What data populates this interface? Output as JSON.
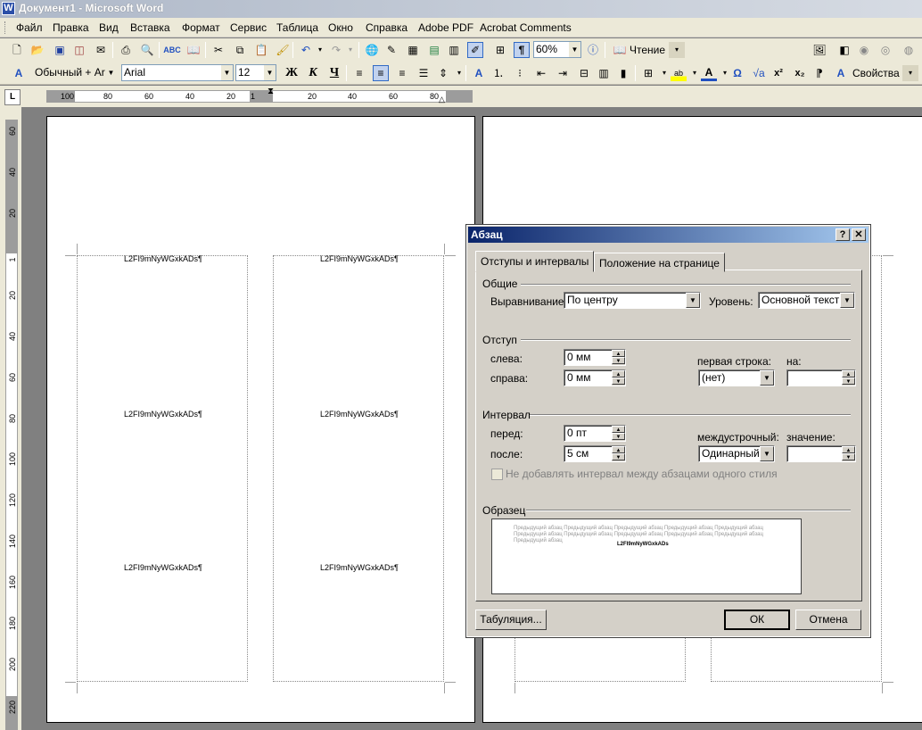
{
  "window": {
    "title": "Документ1 - Microsoft Word",
    "icon": "word-icon"
  },
  "menu": [
    "Файл",
    "Правка",
    "Вид",
    "Вставка",
    "Формат",
    "Сервис",
    "Таблица",
    "Окно",
    "Справка",
    "Adobe PDF",
    "Acrobat Comments"
  ],
  "toolbar": {
    "zoom": "60%",
    "reading_label": "Чтение",
    "style": "Обычный + Aria",
    "font": "Arial",
    "size": "12",
    "properties_label": "Свойства"
  },
  "rulers": {
    "h_ticks": [
      "100",
      "80",
      "60",
      "40",
      "20",
      "1",
      "20",
      "40",
      "60",
      "80"
    ],
    "v_ticks": [
      "60",
      "40",
      "20",
      "1",
      "20",
      "40",
      "60",
      "80",
      "100",
      "120",
      "140",
      "160",
      "180",
      "200",
      "220"
    ]
  },
  "document": {
    "cell_text": "L2FI9mNyWGxkADs¶"
  },
  "dialog": {
    "title": "Абзац",
    "help": "?",
    "close": "✕",
    "tabs": [
      "Отступы и интервалы",
      "Положение на странице"
    ],
    "general": {
      "group": "Общие",
      "alignment_label": "Выравнивание:",
      "alignment_value": "По центру",
      "level_label": "Уровень:",
      "level_value": "Основной текст"
    },
    "indent": {
      "group": "Отступ",
      "left_label": "слева:",
      "left_value": "0 мм",
      "right_label": "справа:",
      "right_value": "0 мм",
      "first_line_label": "первая строка:",
      "first_line_value": "(нет)",
      "by_label": "на:",
      "by_value": ""
    },
    "spacing": {
      "group": "Интервал",
      "before_label": "перед:",
      "before_value": "0 пт",
      "after_label": "после:",
      "after_value": "5 см",
      "line_label": "междустрочный:",
      "line_value": "Одинарный",
      "at_label": "значение:",
      "at_value": "",
      "no_space_label": "Не добавлять интервал между абзацами одного стиля"
    },
    "preview": {
      "group": "Образец",
      "prev_line1": "Предыдущий абзац Предыдущий абзац Предыдущий абзац Предыдущий абзац Предыдущий абзац",
      "prev_line2": "Предыдущий абзац Предыдущий абзац Предыдущий абзац Предыдущий абзац Предыдущий абзац",
      "prev_line3": "Предыдущий абзац",
      "sample": "L2FI9mNyWGxkADs"
    },
    "buttons": {
      "tabs": "Табуляция...",
      "ok": "ОК",
      "cancel": "Отмена"
    }
  }
}
